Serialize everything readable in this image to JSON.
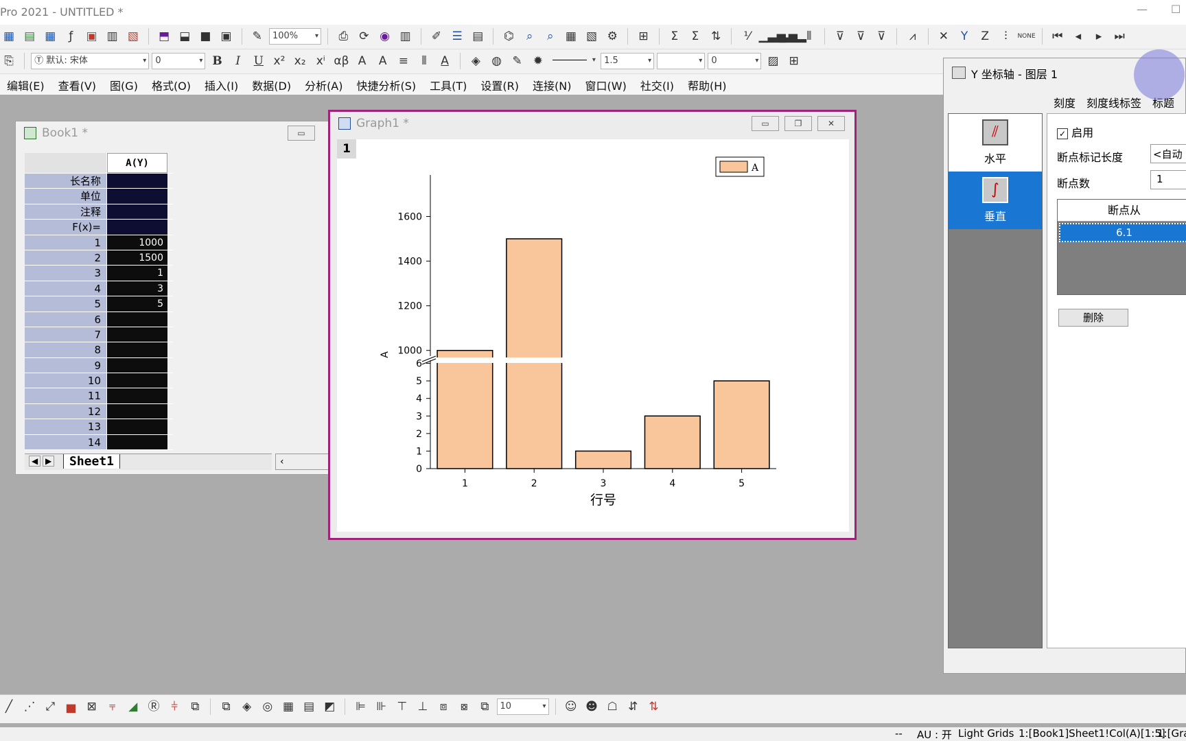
{
  "app_title": "Pro 2021 - UNTITLED *",
  "toolbar": {
    "zoom": "100%",
    "font": "默认: 宋体",
    "font_size": "0",
    "line_width": "1.5",
    "num_value": "0",
    "bottom_value": "10"
  },
  "menu": [
    "编辑(E)",
    "查看(V)",
    "图(G)",
    "格式(O)",
    "插入(I)",
    "数据(D)",
    "分析(A)",
    "快捷分析(S)",
    "工具(T)",
    "设置(R)",
    "连接(N)",
    "窗口(W)",
    "社交(I)",
    "帮助(H)"
  ],
  "book": {
    "title": "Book1 *",
    "column": "A(Y)",
    "row_labels": [
      "长名称",
      "单位",
      "注释",
      "F(x)="
    ],
    "rows": [
      {
        "n": "1",
        "v": "1000"
      },
      {
        "n": "2",
        "v": "1500"
      },
      {
        "n": "3",
        "v": "1"
      },
      {
        "n": "4",
        "v": "3"
      },
      {
        "n": "5",
        "v": "5"
      },
      {
        "n": "6",
        "v": ""
      },
      {
        "n": "7",
        "v": ""
      },
      {
        "n": "8",
        "v": ""
      },
      {
        "n": "9",
        "v": ""
      },
      {
        "n": "10",
        "v": ""
      },
      {
        "n": "11",
        "v": ""
      },
      {
        "n": "12",
        "v": ""
      },
      {
        "n": "13",
        "v": ""
      },
      {
        "n": "14",
        "v": ""
      }
    ],
    "sheet_tab": "Sheet1"
  },
  "graph": {
    "title": "Graph1 *",
    "layer": "1"
  },
  "chart_data": {
    "type": "bar",
    "categories": [
      "1",
      "2",
      "3",
      "4",
      "5"
    ],
    "series": [
      {
        "name": "A",
        "values": [
          1000,
          1500,
          1,
          3,
          5
        ]
      }
    ],
    "xlabel": "行号",
    "ylabel": "A",
    "axis_break": {
      "from": 6.1,
      "to": 950
    },
    "ylim_lower": [
      0,
      6.1
    ],
    "ylim_upper": [
      950,
      1700
    ],
    "yticks_lower": [
      "0",
      "1",
      "2",
      "3",
      "4",
      "5",
      "6"
    ],
    "yticks_upper": [
      "1000",
      "1200",
      "1400",
      "1600"
    ],
    "legend": "top-right",
    "bar_color": "#f9c69b"
  },
  "dialog": {
    "title": "Y 坐标轴 - 图层 1",
    "tabs": [
      "刻度",
      "刻度线标签",
      "标题"
    ],
    "options": [
      "水平",
      "垂直"
    ],
    "enable_label": "启用",
    "break_len_label": "断点标记长度",
    "break_len_value": "<自动",
    "break_count_label": "断点数",
    "break_count_value": "1",
    "table_header": "断点从",
    "table_value": "6.1",
    "delete_label": "删除"
  },
  "status": {
    "au": "AU : 开",
    "grids": "Light Grids",
    "range": "1:[Book1]Sheet1!Col(A)[1:5]",
    "last": "1:[Gra"
  }
}
